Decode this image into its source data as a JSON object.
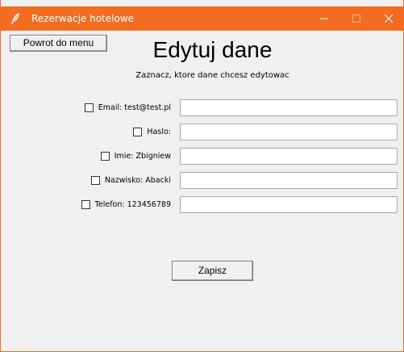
{
  "window": {
    "title": "Rezerwacje hotelowe",
    "titlebar_color": "#f26d21",
    "icon": "feather-icon"
  },
  "buttons": {
    "back_to_menu": "Powrot do menu",
    "save": "Zapisz"
  },
  "header": {
    "title": "Edytuj dane",
    "subtitle": "Zaznacz, ktore dane chcesz edytowac"
  },
  "fields": [
    {
      "key": "email",
      "label": "Email: test@test.pl",
      "checked": false,
      "value": ""
    },
    {
      "key": "haslo",
      "label": "Haslo:",
      "checked": false,
      "value": ""
    },
    {
      "key": "imie",
      "label": "Imie: Zbigniew",
      "checked": false,
      "value": ""
    },
    {
      "key": "nazwisko",
      "label": "Nazwisko: Abacki",
      "checked": false,
      "value": ""
    },
    {
      "key": "telefon",
      "label": "Telefon: 123456789",
      "checked": false,
      "value": ""
    }
  ]
}
